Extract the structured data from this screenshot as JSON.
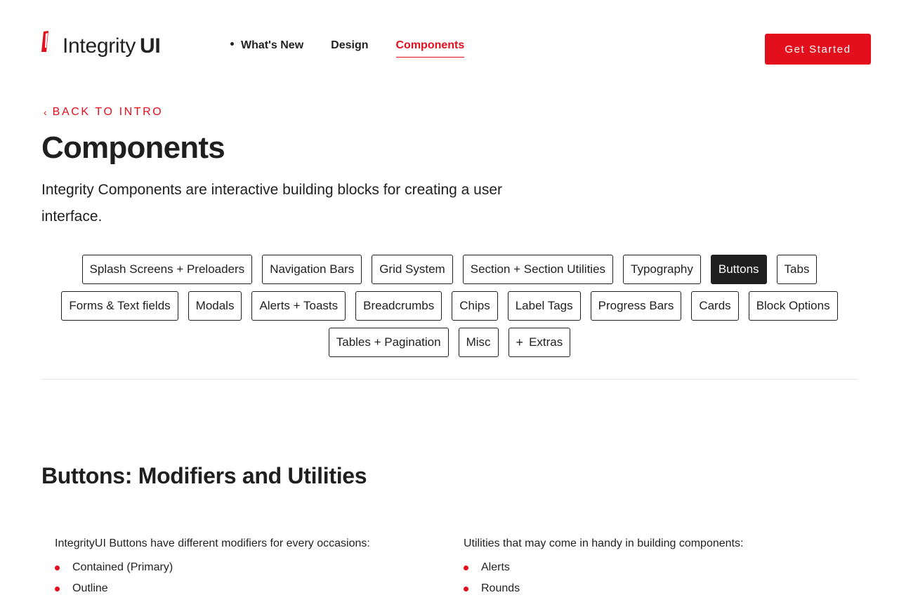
{
  "brand": {
    "name": "Integrity",
    "suffix": "UI",
    "accent": "#e30f1c",
    "logo_icon": "slash-mark-icon"
  },
  "nav": {
    "items": [
      {
        "label": "What's New"
      },
      {
        "label": "Design"
      },
      {
        "label": "Components"
      }
    ],
    "cta": "Get Started"
  },
  "back_link": {
    "icon": "chevron-left-icon",
    "label": "BACK TO INTRO"
  },
  "page": {
    "title": "Components",
    "intro": "Integrity Components are interactive building blocks for creating a user interface."
  },
  "chips": {
    "row1": [
      "Splash Screens + Preloaders",
      "Navigation Bars",
      "Grid System",
      "Section + Section Utilities",
      "Typography",
      "Buttons",
      "Tabs"
    ],
    "row2": [
      "Forms & Text fields",
      "Modals",
      "Alerts + Toasts",
      "Breadcrumbs",
      "Chips",
      "Label Tags",
      "Progress Bars",
      "Cards",
      "Block Options"
    ],
    "row3": [
      "Tables + Pagination",
      "Misc",
      "Extras"
    ],
    "selected": "Buttons",
    "extras_icon": "plus-icon"
  },
  "section": {
    "title": "Buttons: Modifiers and Utilities",
    "left": {
      "intro": "IntegrityUI Buttons have different modifiers for every occasions:",
      "items": [
        "Contained (Primary)",
        "Outline"
      ]
    },
    "right": {
      "intro": "Utilities that may come in handy in building components:",
      "items": [
        "Alerts",
        "Rounds"
      ]
    }
  }
}
